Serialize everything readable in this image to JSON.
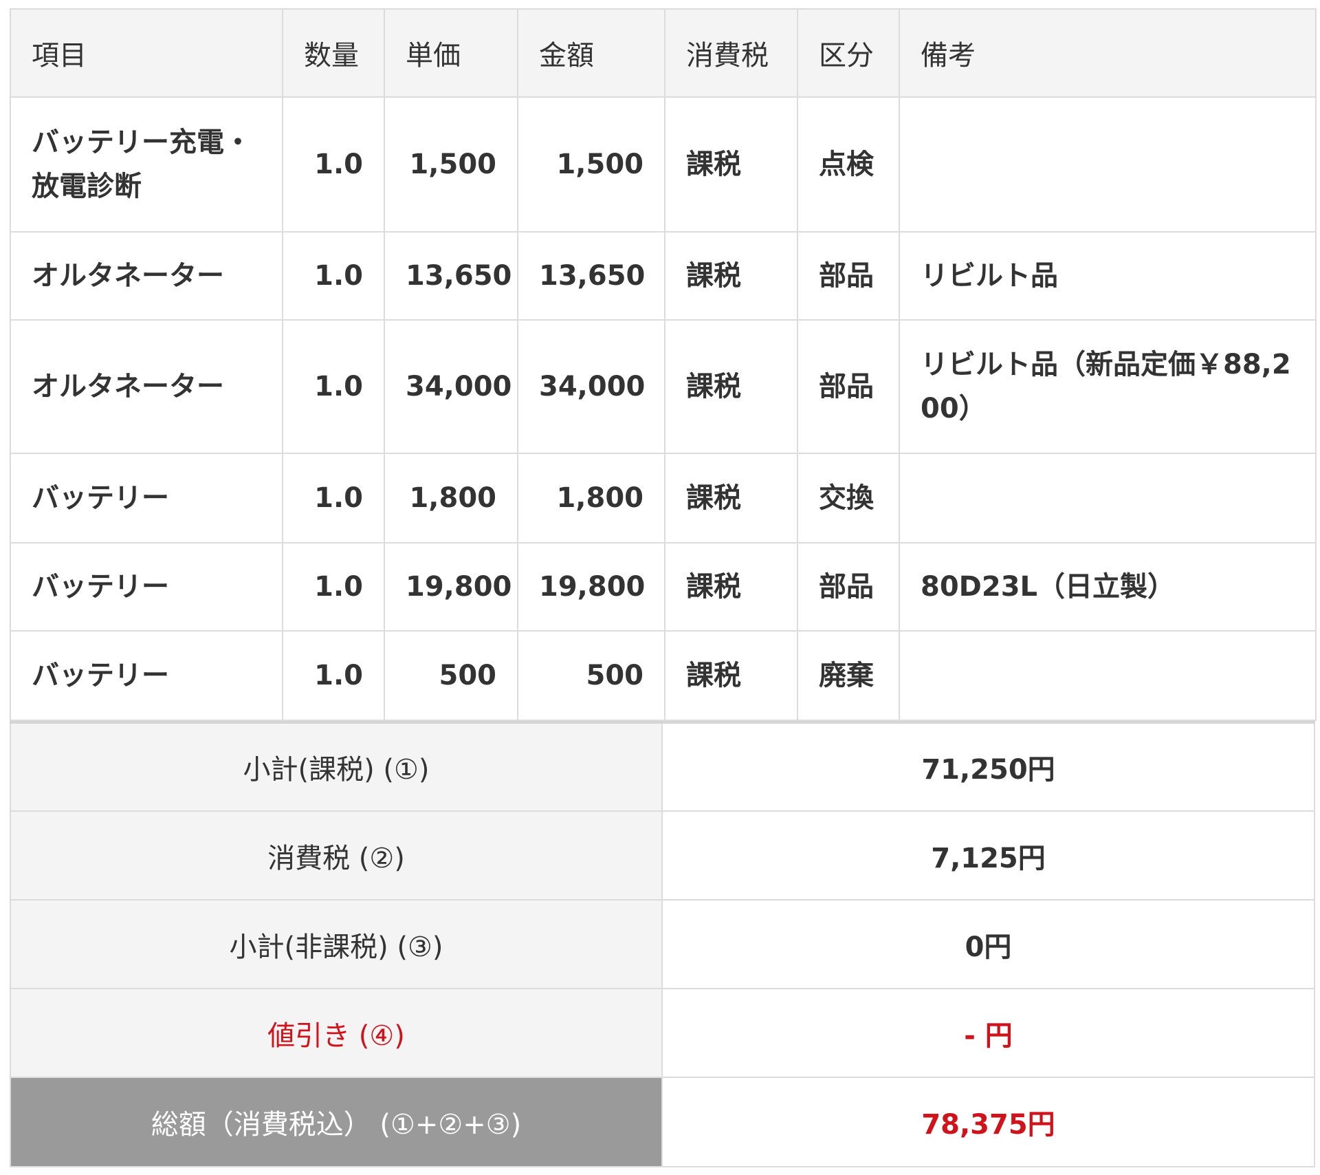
{
  "headers": [
    "項目",
    "数量",
    "単価",
    "金額",
    "消費税",
    "区分",
    "備考"
  ],
  "rows": [
    {
      "item": "バッテリー充電・放電診断",
      "qty": "1.0",
      "unit_price": "1,500",
      "amount": "1,500",
      "tax": "課税",
      "category": "点検",
      "note": ""
    },
    {
      "item": "オルタネーター",
      "qty": "1.0",
      "unit_price": "13,650",
      "amount": "13,650",
      "tax": "課税",
      "category": "部品",
      "note": "リビルト品"
    },
    {
      "item": "オルタネーター",
      "qty": "1.0",
      "unit_price": "34,000",
      "amount": "34,000",
      "tax": "課税",
      "category": "部品",
      "note": "リビルト品（新品定価￥88,200）"
    },
    {
      "item": "バッテリー",
      "qty": "1.0",
      "unit_price": "1,800",
      "amount": "1,800",
      "tax": "課税",
      "category": "交換",
      "note": ""
    },
    {
      "item": "バッテリー",
      "qty": "1.0",
      "unit_price": "19,800",
      "amount": "19,800",
      "tax": "課税",
      "category": "部品",
      "note": "80D23L（日立製）"
    },
    {
      "item": "バッテリー",
      "qty": "1.0",
      "unit_price": "500",
      "amount": "500",
      "tax": "課税",
      "category": "廃棄",
      "note": ""
    }
  ],
  "summary": {
    "subtotal_taxable": {
      "label": "小計(課税) (①)",
      "value": "71,250円"
    },
    "consumption_tax": {
      "label": "消費税 (②)",
      "value": "7,125円"
    },
    "subtotal_nontaxable": {
      "label": "小計(非課税) (③)",
      "value": "0円"
    },
    "discount": {
      "label": "値引き (④)",
      "value": "- 円"
    },
    "total": {
      "label": "総額（消費税込） (①+②+③)",
      "value": "78,375円"
    }
  },
  "colors": {
    "accent_red": "#d0121b",
    "header_bg": "#f4f4f4",
    "total_label_bg": "#9a9a9a",
    "border": "#dcdcdc"
  }
}
